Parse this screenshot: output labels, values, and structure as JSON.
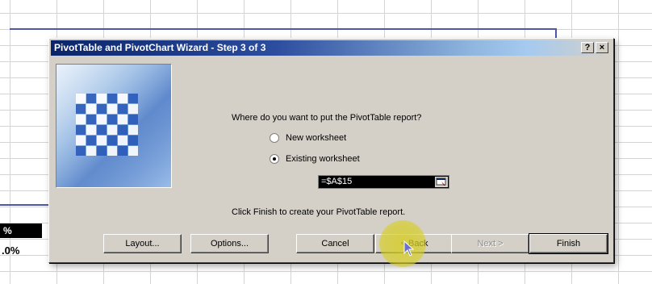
{
  "sheet": {
    "cell_pct": "%",
    "cell_value": ".0%"
  },
  "dialog": {
    "title": "PivotTable and PivotChart Wizard - Step 3 of 3",
    "help_label": "?",
    "close_label": "×",
    "question": "Where do you want to put the PivotTable report?",
    "options": [
      {
        "label": "New worksheet",
        "selected": false
      },
      {
        "label": "Existing worksheet",
        "selected": true
      }
    ],
    "reference_value": "=$A$15",
    "finish_message": "Click Finish to create your PivotTable report.",
    "buttons": {
      "layout": "Layout...",
      "options": "Options...",
      "cancel": "Cancel",
      "back": "< Back",
      "next": "Next >",
      "finish": "Finish"
    }
  },
  "colors": {
    "title_bar_start": "#0a246a",
    "dialog_bg": "#d4d0c8",
    "highlight": "#d6ce28"
  }
}
